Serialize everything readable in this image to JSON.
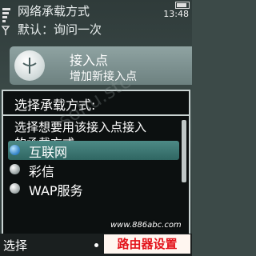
{
  "status": {
    "title": "网络承载方式",
    "time": "13:48"
  },
  "setting": {
    "default_line": "默认：询问一次"
  },
  "access_point": {
    "title": "接入点",
    "subtitle": "增加新接入点"
  },
  "dialog": {
    "title": "选择承载方式:",
    "prompt_line1": "选择想要用该接入点接入",
    "prompt_line2": "的承载方式:",
    "options": [
      {
        "label": "互联网",
        "icon": "globe-icon",
        "selected": true
      },
      {
        "label": "彩信",
        "icon": "mms-icon",
        "selected": false
      },
      {
        "label": "WAP服务",
        "icon": "wap-icon",
        "selected": false
      }
    ]
  },
  "softkeys": {
    "left": "选择"
  },
  "watermark": {
    "url": "www.886abc.com",
    "site": "路由器设置",
    "diagonal": "sohu.stc"
  },
  "colors": {
    "highlight": "#3f7a76",
    "dialog_bg": "#0c1010",
    "watermark_red": "#e3121a"
  }
}
